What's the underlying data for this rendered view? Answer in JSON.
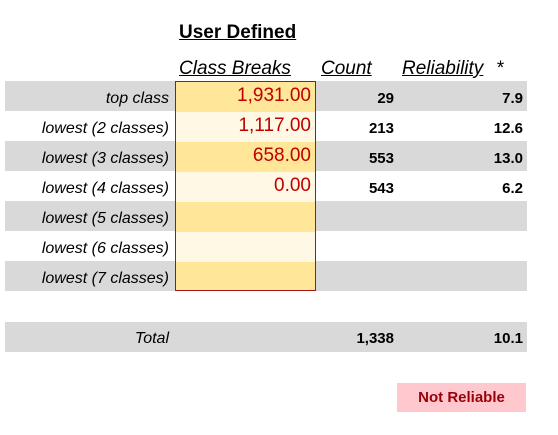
{
  "header": {
    "title": "User Defined",
    "col_class_breaks": "Class Breaks",
    "col_count": "Count",
    "col_reliability": "Reliability",
    "reliability_footnote_mark": "*"
  },
  "rows": [
    {
      "label": "top class",
      "class_break": "1,931.00",
      "count": "29",
      "reliability": "7.9"
    },
    {
      "label": "lowest (2 classes)",
      "class_break": "1,117.00",
      "count": "213",
      "reliability": "12.6"
    },
    {
      "label": "lowest (3 classes)",
      "class_break": "658.00",
      "count": "553",
      "reliability": "13.0"
    },
    {
      "label": "lowest (4 classes)",
      "class_break": "0.00",
      "count": "543",
      "reliability": "6.2"
    },
    {
      "label": "lowest (5 classes)",
      "class_break": "",
      "count": "",
      "reliability": ""
    },
    {
      "label": "lowest (6 classes)",
      "class_break": "",
      "count": "",
      "reliability": ""
    },
    {
      "label": "lowest (7 classes)",
      "class_break": "",
      "count": "",
      "reliability": ""
    }
  ],
  "total": {
    "label": "Total",
    "count": "1,338",
    "reliability": "10.1"
  },
  "status": {
    "label": "Not Reliable",
    "background": "#ffc7ce",
    "color": "#9c0006"
  },
  "colors": {
    "band_grey": "#d9d9d9",
    "input_fill_dark": "#ffe699",
    "input_fill_light": "#fff8e5",
    "input_border": "#a31515",
    "break_value_text": "#c00000"
  }
}
